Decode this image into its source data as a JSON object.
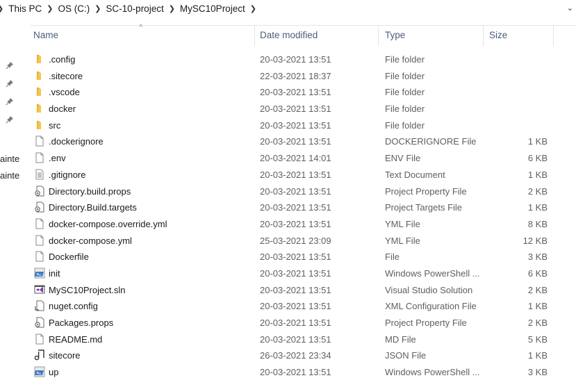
{
  "breadcrumb": {
    "items": [
      "This PC",
      "OS (C:)",
      "SC-10-project",
      "MySC10Project"
    ]
  },
  "left_pane": {
    "labels": [
      "ainte",
      "ainte"
    ]
  },
  "columns": {
    "name": "Name",
    "date": "Date modified",
    "type": "Type",
    "size": "Size"
  },
  "files": [
    {
      "name": ".config",
      "date": "20-03-2021 13:51",
      "type": "File folder",
      "size": "",
      "icon": "folder-icon"
    },
    {
      "name": ".sitecore",
      "date": "22-03-2021 18:37",
      "type": "File folder",
      "size": "",
      "icon": "folder-icon"
    },
    {
      "name": ".vscode",
      "date": "20-03-2021 13:51",
      "type": "File folder",
      "size": "",
      "icon": "folder-icon"
    },
    {
      "name": "docker",
      "date": "20-03-2021 13:51",
      "type": "File folder",
      "size": "",
      "icon": "folder-icon"
    },
    {
      "name": "src",
      "date": "20-03-2021 13:51",
      "type": "File folder",
      "size": "",
      "icon": "folder-icon"
    },
    {
      "name": ".dockerignore",
      "date": "20-03-2021 13:51",
      "type": "DOCKERIGNORE File",
      "size": "1 KB",
      "icon": "file-icon"
    },
    {
      "name": ".env",
      "date": "20-03-2021 14:01",
      "type": "ENV File",
      "size": "6 KB",
      "icon": "file-icon"
    },
    {
      "name": ".gitignore",
      "date": "20-03-2021 13:51",
      "type": "Text Document",
      "size": "1 KB",
      "icon": "text-file-icon"
    },
    {
      "name": "Directory.build.props",
      "date": "20-03-2021 13:51",
      "type": "Project Property File",
      "size": "2 KB",
      "icon": "project-file-icon"
    },
    {
      "name": "Directory.Build.targets",
      "date": "20-03-2021 13:51",
      "type": "Project Targets File",
      "size": "1 KB",
      "icon": "project-file-icon"
    },
    {
      "name": "docker-compose.override.yml",
      "date": "20-03-2021 13:51",
      "type": "YML File",
      "size": "8 KB",
      "icon": "file-icon"
    },
    {
      "name": "docker-compose.yml",
      "date": "25-03-2021 23:09",
      "type": "YML File",
      "size": "12 KB",
      "icon": "file-icon"
    },
    {
      "name": "Dockerfile",
      "date": "20-03-2021 13:51",
      "type": "File",
      "size": "3 KB",
      "icon": "file-icon"
    },
    {
      "name": "init",
      "date": "20-03-2021 13:51",
      "type": "Windows PowerShell ...",
      "size": "6 KB",
      "icon": "powershell-icon"
    },
    {
      "name": "MySC10Project.sln",
      "date": "20-03-2021 13:51",
      "type": "Visual Studio Solution",
      "size": "2 KB",
      "icon": "visual-studio-icon"
    },
    {
      "name": "nuget.config",
      "date": "20-03-2021 13:51",
      "type": "XML Configuration File",
      "size": "1 KB",
      "icon": "config-file-icon"
    },
    {
      "name": "Packages.props",
      "date": "20-03-2021 13:51",
      "type": "Project Property File",
      "size": "2 KB",
      "icon": "project-file-icon"
    },
    {
      "name": "README.md",
      "date": "20-03-2021 13:51",
      "type": "MD File",
      "size": "5 KB",
      "icon": "file-icon"
    },
    {
      "name": "sitecore",
      "date": "26-03-2021 23:34",
      "type": "JSON File",
      "size": "1 KB",
      "icon": "json-file-icon"
    },
    {
      "name": "up",
      "date": "20-03-2021 13:51",
      "type": "Windows PowerShell ...",
      "size": "3 KB",
      "icon": "powershell-icon"
    }
  ],
  "colors": {
    "folder": "#f8c44a",
    "folder_dark": "#e0a52a",
    "header_text": "#4a5d78",
    "secondary_text": "#5f5f5f",
    "powershell": "#3c7fc4",
    "visual_studio": "#7a3ea6"
  }
}
